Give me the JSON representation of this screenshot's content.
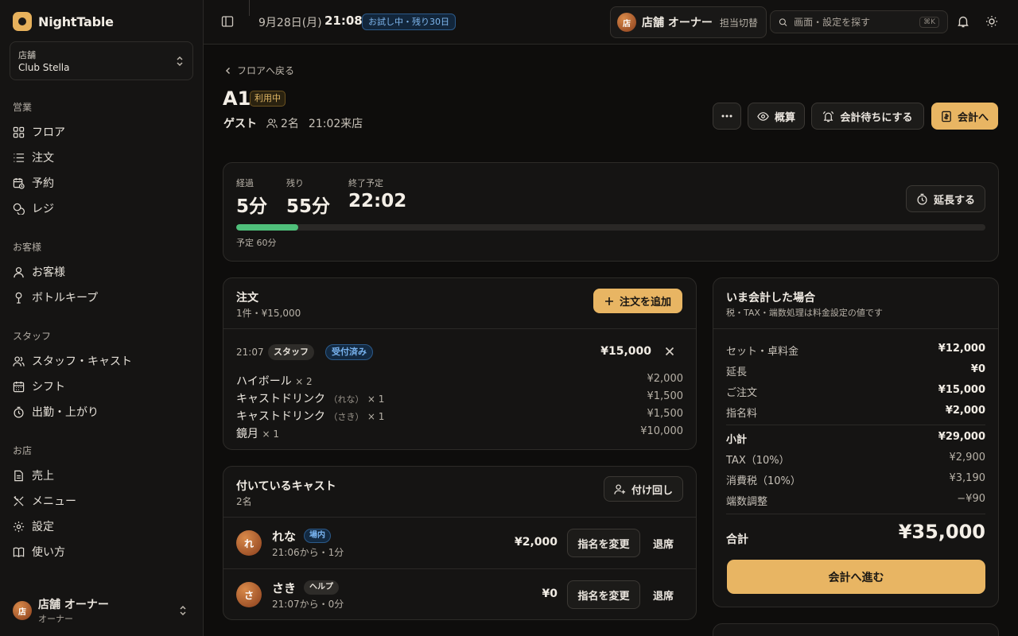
{
  "brand": {
    "name": "NightTable"
  },
  "store": {
    "label": "店舗",
    "value": "Club Stella"
  },
  "nav": {
    "groups": [
      {
        "title": "営業",
        "items": [
          {
            "label": "フロア",
            "icon": "grid-icon"
          },
          {
            "label": "注文",
            "icon": "list-icon"
          },
          {
            "label": "予約",
            "icon": "calendar-clock-icon"
          },
          {
            "label": "レジ",
            "icon": "coins-icon"
          }
        ]
      },
      {
        "title": "お客様",
        "items": [
          {
            "label": "お客様",
            "icon": "user-icon"
          },
          {
            "label": "ボトルキープ",
            "icon": "bottle-icon"
          }
        ]
      },
      {
        "title": "スタッフ",
        "items": [
          {
            "label": "スタッフ・キャスト",
            "icon": "users-icon"
          },
          {
            "label": "シフト",
            "icon": "calendar-icon"
          },
          {
            "label": "出勤・上がり",
            "icon": "timer-icon"
          }
        ]
      },
      {
        "title": "お店",
        "items": [
          {
            "label": "売上",
            "icon": "document-icon"
          },
          {
            "label": "メニュー",
            "icon": "utensils-icon"
          },
          {
            "label": "設定",
            "icon": "gear-icon"
          },
          {
            "label": "使い方",
            "icon": "book-icon"
          }
        ]
      }
    ]
  },
  "user": {
    "avatar": "店",
    "name": "店舗 オーナー",
    "role": "オーナー"
  },
  "topbar": {
    "date": "9月28日(月)",
    "time": "21:08",
    "trial": "お試し中・残り30日",
    "owner_avatar": "店",
    "owner_name": "店舗 オーナー",
    "switch_label": "担当切替",
    "search_placeholder": "画面・設定を探す",
    "shortcut": "⌘K"
  },
  "page": {
    "back_label": "フロアへ戻る",
    "table_name": "A1",
    "status": "利用中",
    "guest_label": "ゲスト",
    "people": "2名",
    "arrival": "21:02来店",
    "actions": {
      "estimate": "概算",
      "wait_checkout": "会計待ちにする",
      "checkout": "会計へ"
    }
  },
  "timer": {
    "elapsed_label": "経過",
    "elapsed": "5分",
    "remaining_label": "残り",
    "remaining": "55分",
    "end_label": "終了予定",
    "end": "22:02",
    "extend_label": "延長する",
    "progress": 0.083,
    "plan_note": "予定 60分",
    "accent": "#4fbf7a"
  },
  "orders": {
    "title": "注文",
    "summary": "1件・¥15,000",
    "add_label": "注文を追加",
    "entry": {
      "time": "21:07",
      "by": "スタッフ",
      "status": "受付済み",
      "total": "¥15,000",
      "lines": [
        {
          "name": "ハイボール",
          "note": "",
          "qty": "× 2",
          "price": "¥2,000"
        },
        {
          "name": "キャストドリンク",
          "note": "（れな）",
          "qty": "× 1",
          "price": "¥1,500"
        },
        {
          "name": "キャストドリンク",
          "note": "（さき）",
          "qty": "× 1",
          "price": "¥1,500"
        },
        {
          "name": "鏡月",
          "note": "",
          "qty": "× 1",
          "price": "¥10,000"
        }
      ]
    }
  },
  "casts": {
    "title": "付いているキャスト",
    "count": "2名",
    "reassign_label": "付け回し",
    "rows": [
      {
        "avatar": "れ",
        "name": "れな",
        "tag": "場内",
        "tag_style": "blue",
        "since": "21:06から・1分",
        "fee": "¥2,000",
        "change_label": "指名を変更",
        "leave_label": "退席"
      },
      {
        "avatar": "さ",
        "name": "さき",
        "tag": "ヘルプ",
        "tag_style": "gray",
        "since": "21:07から・0分",
        "fee": "¥0",
        "change_label": "指名を変更",
        "leave_label": "退席"
      }
    ]
  },
  "bill": {
    "title": "いま会計した場合",
    "note": "税・TAX・端数処理は料金設定の値です",
    "lines": [
      {
        "label": "セット・卓料金",
        "amount": "¥12,000"
      },
      {
        "label": "延長",
        "amount": "¥0"
      },
      {
        "label": "ご注文",
        "amount": "¥15,000"
      },
      {
        "label": "指名料",
        "amount": "¥2,000"
      }
    ],
    "subtotal_label": "小計",
    "subtotal": "¥29,000",
    "adjustments": [
      {
        "label": "TAX（10%）",
        "amount": "¥2,900"
      },
      {
        "label": "消費税（10%）",
        "amount": "¥3,190"
      },
      {
        "label": "端数調整",
        "amount": "−¥90"
      }
    ],
    "total_label": "合計",
    "total": "¥35,000",
    "proceed_label": "会計へ進む"
  },
  "colors": {
    "accent": "#e8b563",
    "background": "#0e0d0c",
    "info": "#78b3ef",
    "success": "#4fbf7a"
  }
}
